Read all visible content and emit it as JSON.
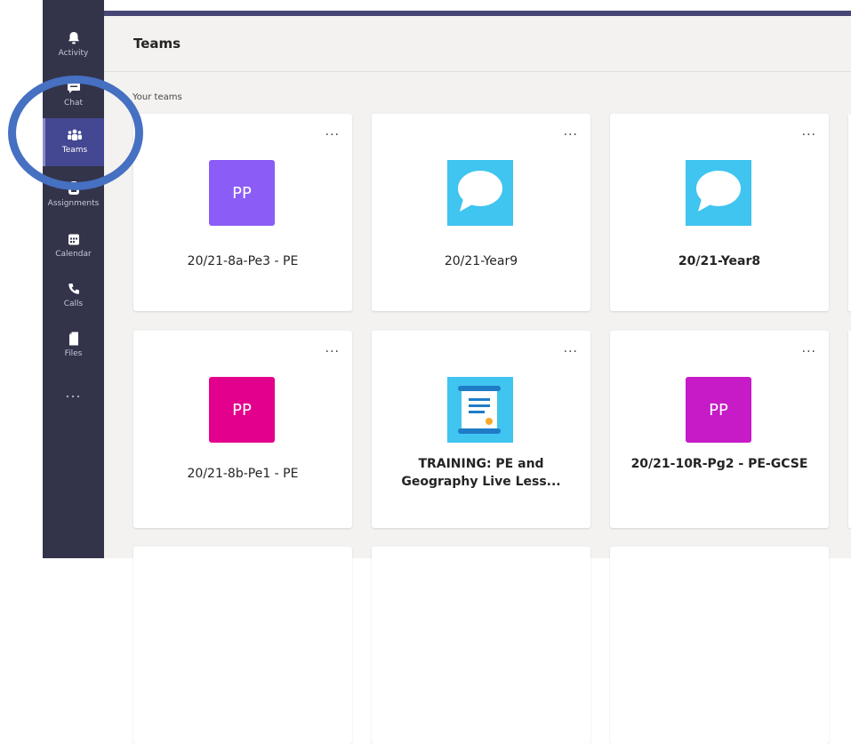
{
  "rail": {
    "items": [
      {
        "label": "Activity",
        "icon": "bell-icon"
      },
      {
        "label": "Chat",
        "icon": "chat-icon"
      },
      {
        "label": "Teams",
        "icon": "teams-icon",
        "active": true
      },
      {
        "label": "Assignments",
        "icon": "backpack-icon"
      },
      {
        "label": "Calendar",
        "icon": "calendar-icon"
      },
      {
        "label": "Calls",
        "icon": "phone-icon"
      },
      {
        "label": "Files",
        "icon": "file-icon"
      }
    ],
    "more_label": "..."
  },
  "header": {
    "title": "Teams"
  },
  "section_label": "Your teams",
  "cards": [
    {
      "name": "20/21-8a-Pe3 - PE",
      "initials": "PP",
      "color": "#8b5cf6",
      "bold": false,
      "more": "...",
      "icon": "initials"
    },
    {
      "name": "20/21-Year9",
      "initials": "",
      "color": "#40c4f0",
      "bold": false,
      "more": "...",
      "icon": "speech-bubble-icon"
    },
    {
      "name": "20/21-Year8",
      "initials": "",
      "color": "#40c4f0",
      "bold": true,
      "more": "...",
      "icon": "speech-bubble-icon"
    },
    {
      "name": "20/21-8b-Pe1 - PE",
      "initials": "PP",
      "color": "#e3008c",
      "bold": false,
      "more": "...",
      "icon": "initials"
    },
    {
      "name": "TRAINING: PE and Geography Live Less...",
      "initials": "",
      "color": "#40c4f0",
      "bold": true,
      "more": "...",
      "icon": "scroll-icon"
    },
    {
      "name": "20/21-10R-Pg2 - PE-GCSE",
      "initials": "PP",
      "color": "#c61bc6",
      "bold": true,
      "more": "...",
      "icon": "initials"
    }
  ],
  "colors": {
    "rail": "#33344a",
    "accent": "#464775",
    "annotation": "#4670c1"
  }
}
